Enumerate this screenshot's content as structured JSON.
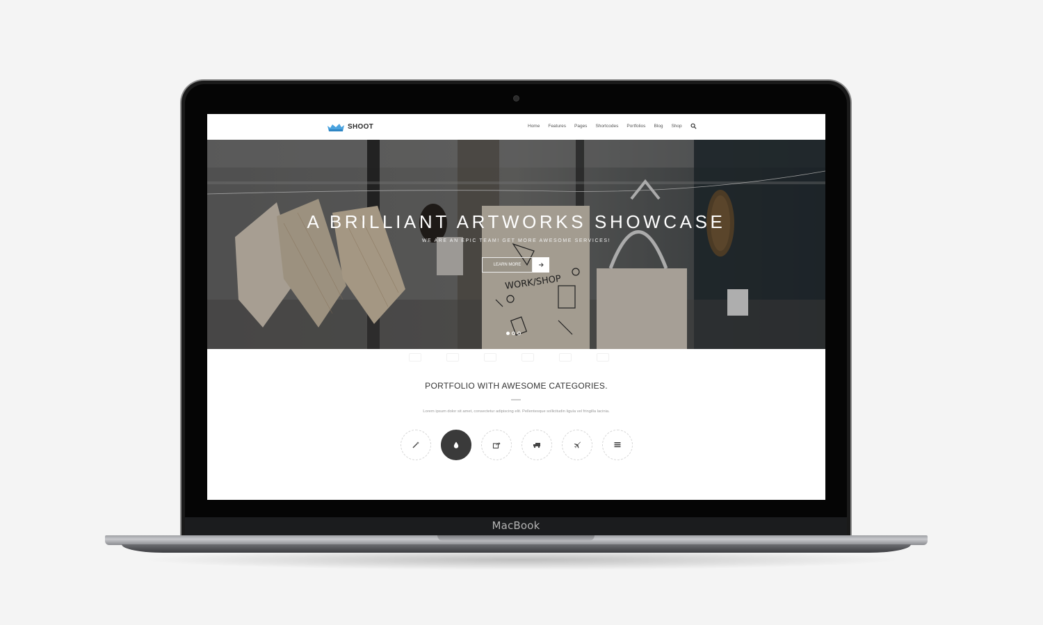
{
  "site": {
    "logo_text": "SHOOT",
    "nav": [
      "Home",
      "Features",
      "Pages",
      "Shortcodes",
      "Portfolios",
      "Blog",
      "Shop"
    ],
    "search_icon": "search-icon"
  },
  "hero": {
    "title": "A BRILLIANT ARTWORKS SHOWCASE",
    "subtitle": "WE ARE AN EPIC TEAM! GET MORE AWESOME SERVICES!",
    "button_label": "LEARN MORE",
    "button_icon": "arrow-right-icon",
    "slides": 3,
    "active_slide": 1
  },
  "portfolio": {
    "title": "PORTFOLIO WITH AWESOME CATEGORIES.",
    "description": "Lorem ipsum dolor sit amet, consectetur adipiscing elit. Pellentesque sollicitudin ligula vel fringilla lacinia.",
    "categories": [
      {
        "icon": "magic-wand-icon",
        "active": false
      },
      {
        "icon": "drop-icon",
        "active": true
      },
      {
        "icon": "share-icon",
        "active": false
      },
      {
        "icon": "truck-icon",
        "active": false
      },
      {
        "icon": "plane-icon",
        "active": false
      },
      {
        "icon": "list-icon",
        "active": false
      }
    ]
  },
  "device": {
    "brand": "MacBook"
  },
  "colors": {
    "accent": "#3a3a3a",
    "logo": "#4aa3df"
  }
}
